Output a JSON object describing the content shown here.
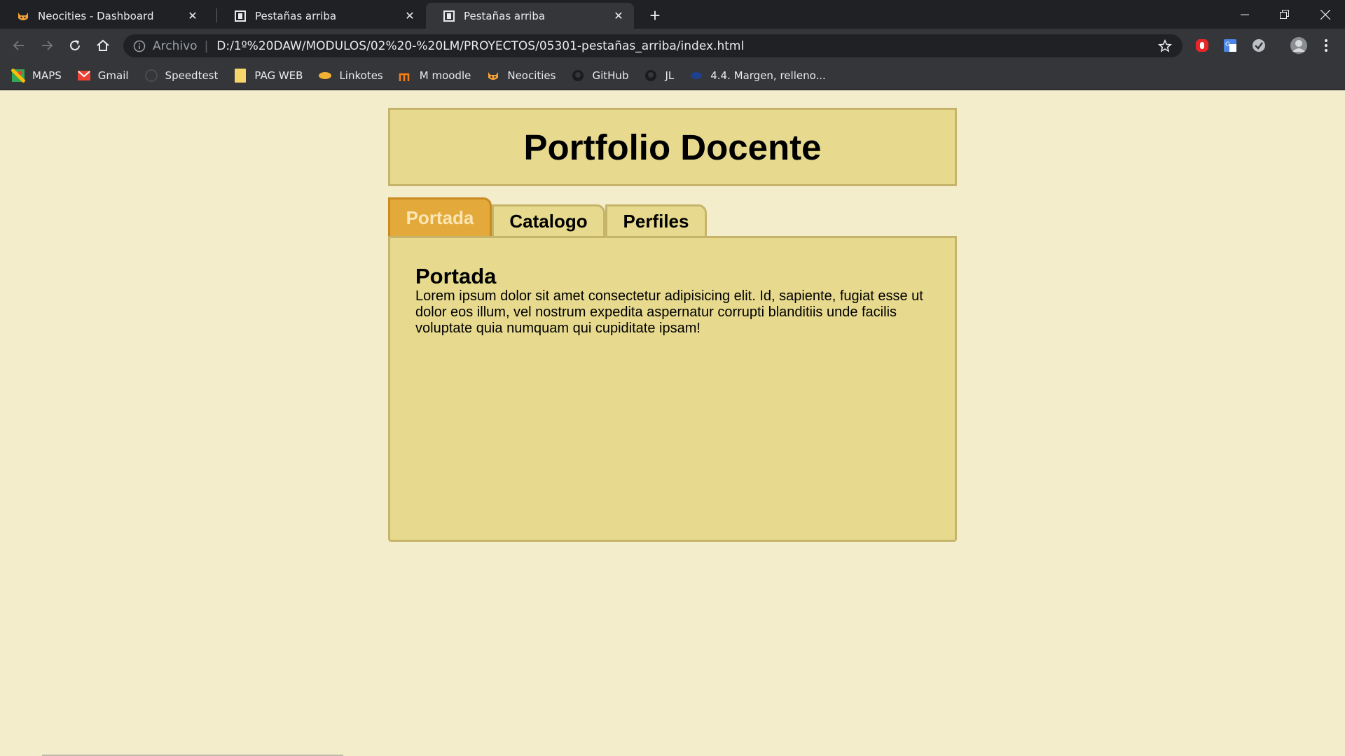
{
  "browser": {
    "tabs": [
      {
        "title": "Neocities - Dashboard",
        "icon": "neocities-cat-icon"
      },
      {
        "title": "Pestañas arriba",
        "icon": "page-icon"
      },
      {
        "title": "Pestañas arriba",
        "icon": "page-icon",
        "active": true
      }
    ],
    "address": {
      "scheme_label": "Archivo",
      "url": "D:/1º%20DAW/MODULOS/02%20-%20LM/PROYECTOS/05301-pestañas_arriba/index.html"
    },
    "bookmarks": [
      {
        "label": "MAPS",
        "icon": "maps-icon"
      },
      {
        "label": "Gmail",
        "icon": "gmail-icon"
      },
      {
        "label": "Speedtest",
        "icon": "speedtest-icon"
      },
      {
        "label": "PAG WEB",
        "icon": "folder-icon"
      },
      {
        "label": "Linkotes",
        "icon": "linkotes-icon"
      },
      {
        "label": "M moodle",
        "icon": "moodle-icon"
      },
      {
        "label": "Neocities",
        "icon": "neocities-cat-icon"
      },
      {
        "label": "GitHub",
        "icon": "github-icon"
      },
      {
        "label": "JL",
        "icon": "github-icon"
      },
      {
        "label": "4.4. Margen, relleno...",
        "icon": "globe-icon"
      }
    ]
  },
  "site": {
    "title": "Portfolio Docente",
    "tabs": [
      "Portada",
      "Catalogo",
      "Perfiles"
    ],
    "active_tab": "Portada",
    "panel": {
      "heading": "Portada",
      "text": "Lorem ipsum dolor sit amet consectetur adipisicing elit. Id, sapiente, fugiat esse ut dolor eos illum, vel nostrum expedita aspernatur corrupti blanditiis unde facilis voluptate quia numquam qui cupiditate ipsam!"
    }
  },
  "colors": {
    "page_bg": "#f4edcb",
    "box_bg": "#e7da8e",
    "box_border": "#c7b46b",
    "active_tab_bg": "#e3a93a",
    "active_tab_text": "#fbe6b6"
  }
}
